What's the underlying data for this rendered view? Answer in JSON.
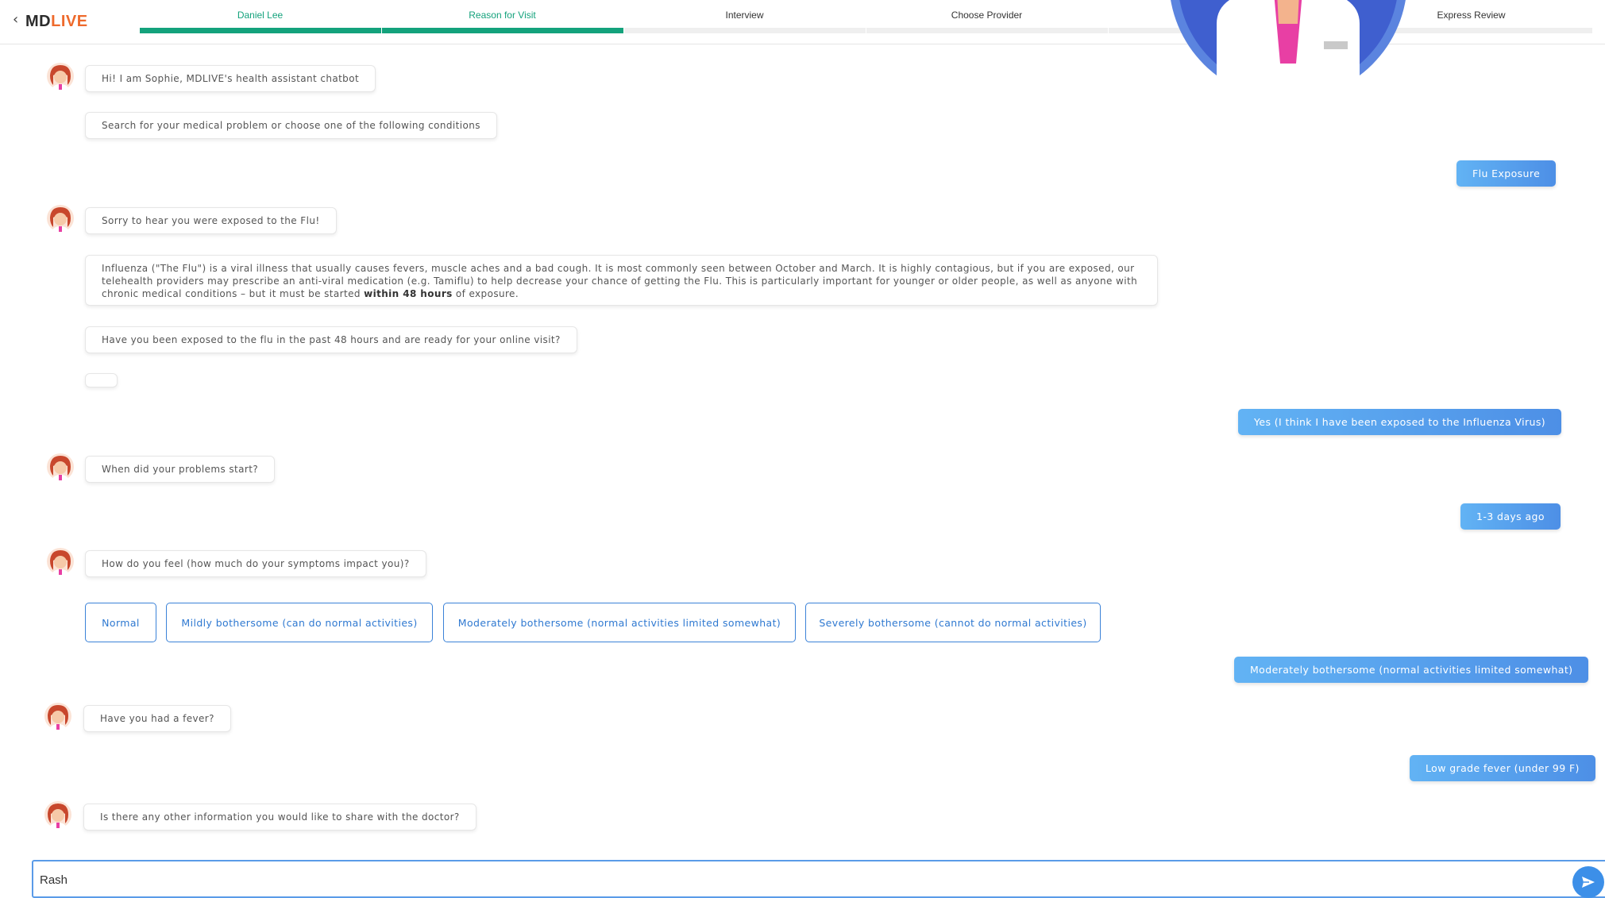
{
  "header": {
    "back_icon": "chevron-left-icon",
    "logo_md": "MD",
    "logo_live": "LIVE",
    "steps": [
      {
        "label": "Daniel Lee",
        "state": "done"
      },
      {
        "label": "Reason for Visit",
        "state": "done"
      },
      {
        "label": "Interview",
        "state": "current"
      },
      {
        "label": "Choose Provider",
        "state": "todo"
      },
      {
        "label": "",
        "state": "todo"
      },
      {
        "label": "Express Review",
        "state": "todo"
      }
    ]
  },
  "chat": {
    "m1": "Hi! I am Sophie, MDLIVE's health assistant chatbot",
    "m2": "Search for your medical problem or choose one of the following conditions",
    "u1": "Flu Exposure",
    "m3": "Sorry to hear you were exposed to the Flu!",
    "m4a": "Influenza (\"The Flu\") is a viral illness that usually causes fevers, muscle aches and a bad cough. It is most commonly seen between October and March. It is highly contagious, but if you are exposed, our telehealth providers may prescribe an anti-viral medication (e.g. Tamiflu) to help decrease your chance of getting the Flu. This is particularly important for younger or older people, as well as anyone with chronic medical conditions – but it must be started ",
    "m4b": "within 48 hours",
    "m4c": " of exposure.",
    "m5": "Have you been exposed to the flu in the past 48 hours and are ready for your online visit?",
    "u2": "Yes (I think I have been exposed to the Influenza Virus)",
    "m6": "When did your problems start?",
    "u3": "1-3 days ago",
    "m7": "How do you feel (how much do your symptoms impact you)?",
    "options": [
      "Normal",
      "Mildly bothersome (can do normal activities)",
      "Moderately bothersome (normal activities limited somewhat)",
      "Severely bothersome (cannot do normal activities)"
    ],
    "u4": "Moderately bothersome (normal activities limited somewhat)",
    "m8": "Have you had a fever?",
    "u5": "Low grade fever (under 99 F)",
    "m9": "Is there any other information you would like to share with the doctor?"
  },
  "composer": {
    "value": "Rash",
    "send_icon": "send-icon"
  },
  "colors": {
    "accent_green": "#14a27c",
    "accent_blue": "#3b82d8",
    "logo_orange": "#ee6a2c"
  }
}
